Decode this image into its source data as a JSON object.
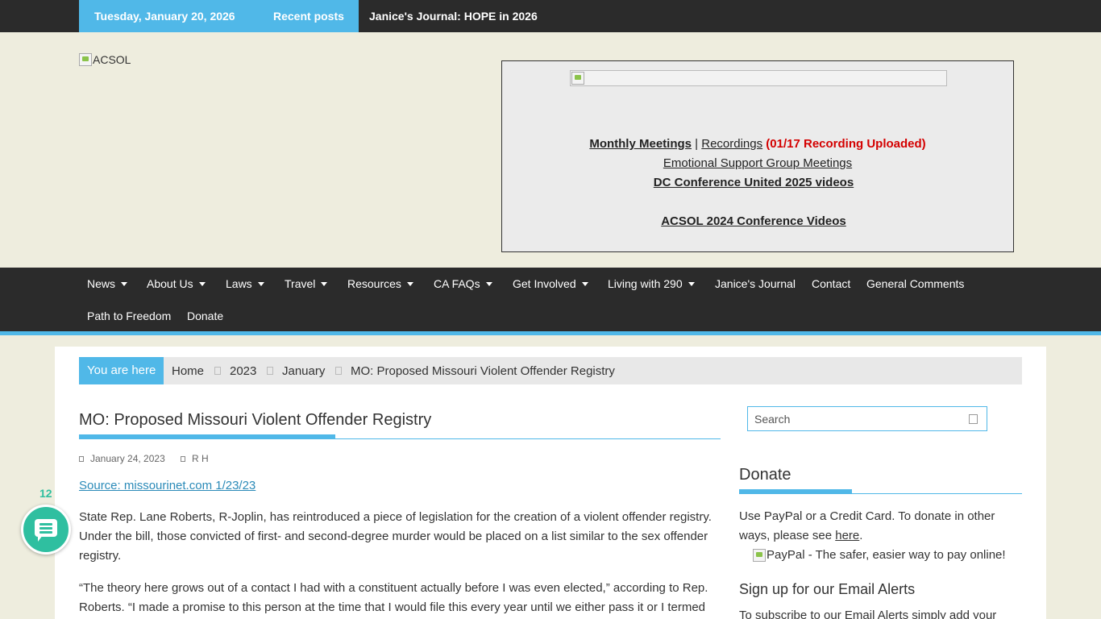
{
  "topbar": {
    "date": "Tuesday, January 20, 2026",
    "recent_label": "Recent posts",
    "ticker": "Janice's Journal: HOPE in 2026"
  },
  "header": {
    "logo_alt": "ACSOL",
    "monthly_meetings": "Monthly Meetings",
    "separator": "|",
    "recordings": "Recordings",
    "recording_note": "(01/17 Recording Uploaded)",
    "support_group": "Emotional Support Group Meetings",
    "dc_conference": "DC Conference United 2025 videos",
    "acsol_conference": "ACSOL 2024 Conference Videos"
  },
  "nav": {
    "items": [
      {
        "label": "News"
      },
      {
        "label": "About Us"
      },
      {
        "label": "Laws"
      },
      {
        "label": "Travel"
      },
      {
        "label": "Resources"
      },
      {
        "label": "CA FAQs"
      },
      {
        "label": "Get Involved"
      },
      {
        "label": "Living with 290"
      },
      {
        "label": "Janice's Journal"
      },
      {
        "label": "Contact"
      },
      {
        "label": "General Comments"
      },
      {
        "label": "Path to Freedom"
      },
      {
        "label": "Donate"
      }
    ]
  },
  "breadcrumb": {
    "here": "You are here",
    "items": [
      "Home",
      "2023",
      "January",
      "MO: Proposed Missouri Violent Offender Registry"
    ]
  },
  "article": {
    "title": "MO: Proposed Missouri Violent Offender Registry",
    "date": "January 24, 2023",
    "author": "R H",
    "source": "Source: missourinet.com 1/23/23",
    "para1": "State Rep. Lane Roberts, R-Joplin, has reintroduced a piece of legislation for the creation of a violent offender registry. Under the bill, those convicted of first- and second-degree murder would be placed on a list similar to the sex offender registry.",
    "para2": "“The theory here grows out of a contact I had with a constituent actually before I was even elected,” according to Rep. Roberts. “I made a promise to this person at the time that I would file this every year until we either pass it or I termed"
  },
  "comments": {
    "count": "12"
  },
  "sidebar": {
    "search_placeholder": "Search",
    "donate_title": "Donate",
    "donate_text": "Use PayPal or a Credit Card. To donate in other ways, please see ",
    "donate_link": "here",
    "donate_end": ".",
    "paypal_alt": "PayPal - The safer, easier way to pay online!",
    "email_title": "Sign up for our Email Alerts",
    "email_text": "To subscribe to our Email Alerts simply add your"
  },
  "colors": {
    "accent": "#50b8e8",
    "dark": "#2b2b2b",
    "page_bg": "#eeedde",
    "alert_red": "#d40000",
    "comment_green": "#2fbfa0"
  }
}
